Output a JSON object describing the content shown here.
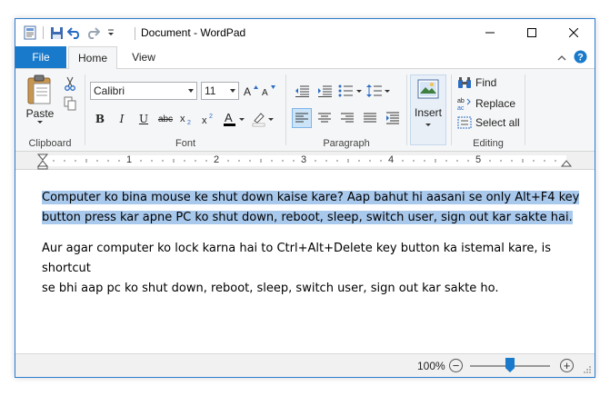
{
  "window": {
    "title": "Document - WordPad",
    "accent": "#1979ca"
  },
  "tabs": {
    "file": "File",
    "home": "Home",
    "view": "View"
  },
  "ribbon": {
    "clipboard": {
      "label": "Clipboard",
      "paste": "Paste"
    },
    "font": {
      "label": "Font",
      "name": "Calibri",
      "size": "11"
    },
    "paragraph": {
      "label": "Paragraph"
    },
    "insert": {
      "label": "Insert"
    },
    "editing": {
      "label": "Editing",
      "find": "Find",
      "replace": "Replace",
      "select_all": "Select all"
    }
  },
  "ruler": {
    "numbers": [
      "1",
      "2",
      "3",
      "4",
      "5"
    ]
  },
  "document": {
    "para1_line1": "Computer ko bina mouse ke shut down kaise kare? Aap bahut hi aasani se only Alt+F4 key",
    "para1_line2": "button press kar apne PC ko shut down, reboot, sleep, switch user, sign out kar sakte hai.",
    "para2_line1": "Aur agar computer ko lock karna hai to Ctrl+Alt+Delete key button ka istemal kare, is shortcut",
    "para2_line2": "se bhi aap pc ko shut down, reboot, sleep, switch user, sign out kar sakte ho.",
    "selection_color": "#a8c8ec"
  },
  "statusbar": {
    "zoom": "100%",
    "zoom_minus": "−",
    "zoom_plus": "+"
  }
}
